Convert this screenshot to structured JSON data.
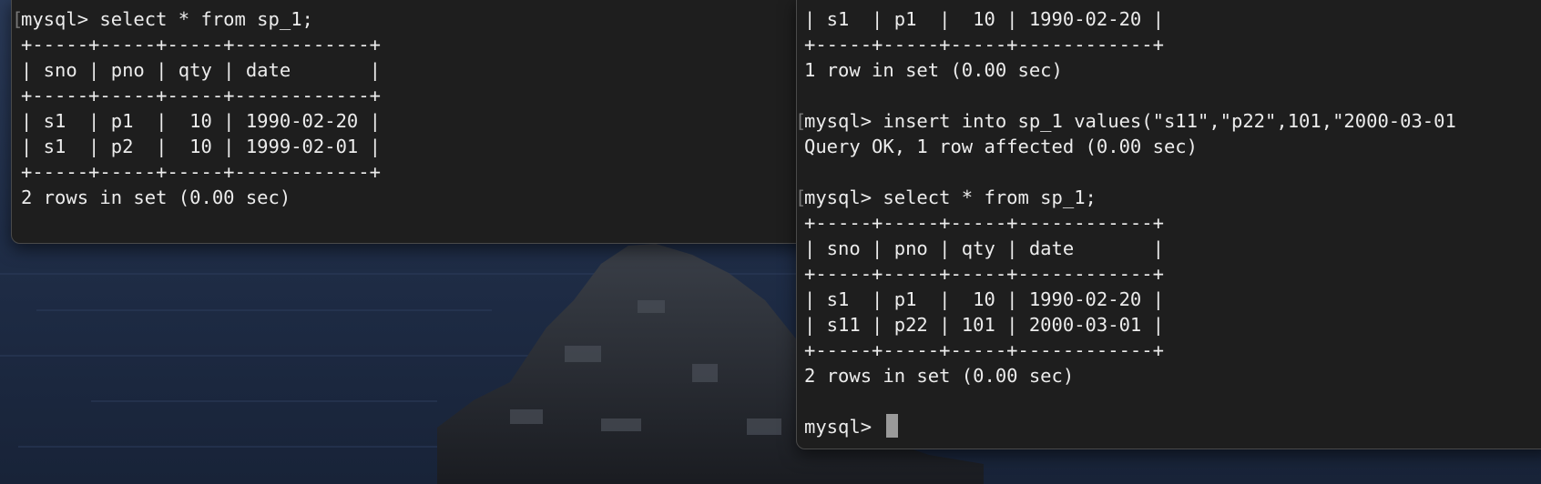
{
  "colors": {
    "terminal_bg": "#1e1e1e",
    "terminal_text": "#ececec",
    "desktop_sea": "#1e2a40",
    "cursor": "#9a9a9a"
  },
  "left_terminal": {
    "lines": [
      "mysql> select * from sp_1;",
      "+-----+-----+-----+------------+",
      "| sno | pno | qty | date       |",
      "+-----+-----+-----+------------+",
      "| s1  | p1  |  10 | 1990-02-20 |",
      "| s1  | p2  |  10 | 1999-02-01 |",
      "+-----+-----+-----+------------+",
      "2 rows in set (0.00 sec)"
    ]
  },
  "right_terminal": {
    "lines": [
      "| s1  | p1  |  10 | 1990-02-20 |",
      "+-----+-----+-----+------------+",
      "1 row in set (0.00 sec)",
      "",
      "mysql> insert into sp_1 values(\"s11\",\"p22\",101,\"2000-03-01",
      "Query OK, 1 row affected (0.00 sec)",
      "",
      "mysql> select * from sp_1;",
      "+-----+-----+-----+------------+",
      "| sno | pno | qty | date       |",
      "+-----+-----+-----+------------+",
      "| s1  | p1  |  10 | 1990-02-20 |",
      "| s11 | p22 | 101 | 2000-03-01 |",
      "+-----+-----+-----+------------+",
      "2 rows in set (0.00 sec)",
      ""
    ],
    "prompt": "mysql> "
  }
}
